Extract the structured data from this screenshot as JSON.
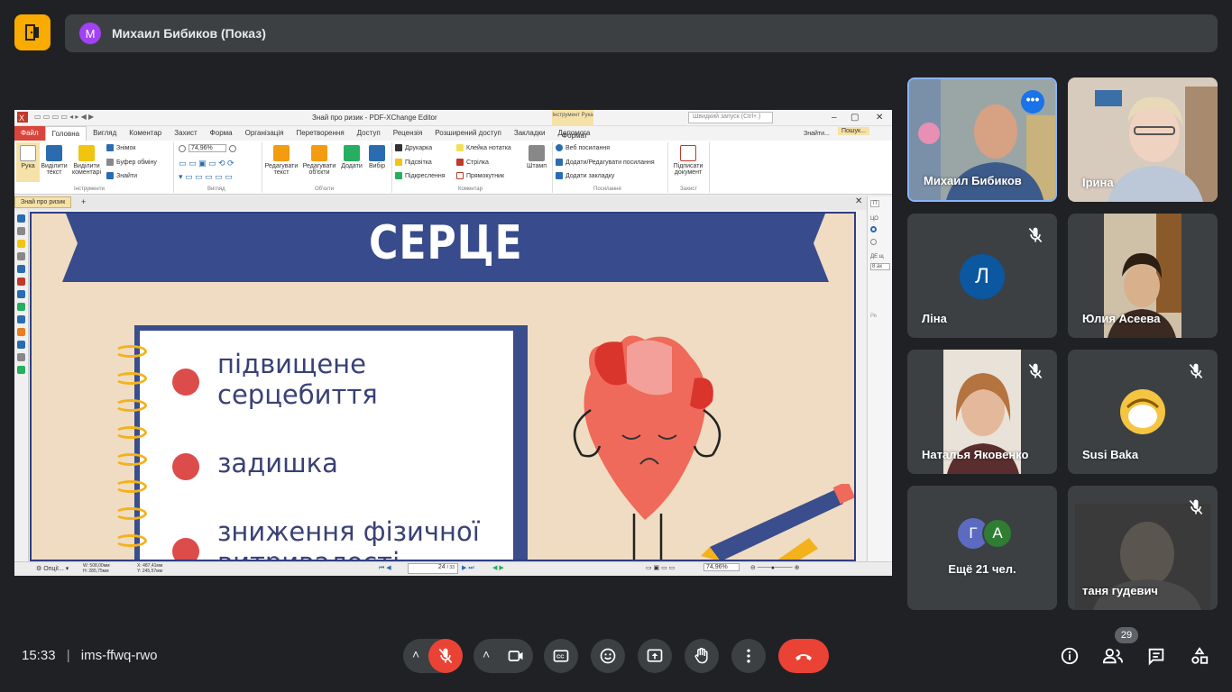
{
  "topbar": {
    "presenter_initial": "М",
    "presenter_label": "Михаил Бибиков (Показ)"
  },
  "pdf_editor": {
    "window_title": "Знай про ризик - PDF-XChange Editor",
    "quick_launch_placeholder": "Швидкий запуск (Ctrl+.)",
    "tool_context": "Інструмент Рука",
    "menu": [
      "Файл",
      "Головна",
      "Вигляд",
      "Коментар",
      "Захист",
      "Форма",
      "Організація",
      "Перетворення",
      "Доступ",
      "Рецензія",
      "Розширений доступ",
      "Закладки",
      "Допомога"
    ],
    "menu_format": "Формат",
    "menu_right": [
      "Знайти...",
      "Пошук..."
    ],
    "ribbon": {
      "hand": "Рука",
      "select_text": "Виділити текст",
      "select_comments": "Виділити коментарі",
      "snapshot": "Знімок",
      "clipboard": "Буфер обміну",
      "find": "Знайти",
      "zoom": "74,96%",
      "edit_text": "Редагувати текст",
      "edit_objects": "Редагувати об'єкти",
      "add": "Додати",
      "select": "Вибір",
      "typewriter": "Друкарка",
      "highlight": "Підсвітка",
      "underline": "Підкреслення",
      "sticky_note": "Клейка нотатка",
      "arrow": "Стрілка",
      "rectangle": "Прямокутник",
      "stamp": "Штамп",
      "web_links": "Веб посилання",
      "add_edit_links": "Додати/Редагувати посилання",
      "add_bookmark": "Додати закладку",
      "sign_document": "Підписати документ",
      "groups": [
        "Інструменти",
        "Вигляд",
        "Об'єкти",
        "Коментар",
        "Посилання",
        "Захист"
      ]
    },
    "doc_tab": "Знай про ризик",
    "status": {
      "options": "Опції...",
      "dims_w": "W: 508,00мм",
      "dims_h": "H: 285,75мм",
      "coord_x": "X: 487,41мм",
      "coord_y": "Y: 245,57мм",
      "page": "24",
      "page_total": "/ 33",
      "zoom": "74,96%"
    },
    "right_pane": [
      "П",
      "ЦО",
      "ДЕ щ",
      "8 ак",
      "Ре"
    ]
  },
  "slide": {
    "title": "СЕРЦЕ",
    "bullets": [
      "підвищене серцебиття",
      "задишка",
      "зниження фізичної витривалості"
    ],
    "colors": {
      "banner": "#384b8d",
      "background": "#efdcc2",
      "bullet": "#dc4c4a",
      "heart": "#ef6a5a"
    }
  },
  "participants": [
    {
      "name": "Михаил Бибиков",
      "type": "video",
      "active": true
    },
    {
      "name": "Ірина",
      "type": "video"
    },
    {
      "name": "Ліна",
      "type": "avatar",
      "initial": "Л",
      "color": "#1a5fb4",
      "muted": true
    },
    {
      "name": "Юлия Асеева",
      "type": "video"
    },
    {
      "name": "Наталья Яковенко",
      "type": "video",
      "muted": true
    },
    {
      "name": "Susi Baka",
      "type": "avatar-image",
      "muted": true
    },
    {
      "name": "Ещё 21 чел.",
      "type": "more",
      "initials": [
        "Г",
        "А"
      ],
      "colors": [
        "#5c6bc0",
        "#2e7d32"
      ]
    },
    {
      "name": "таня гудевич",
      "type": "video",
      "muted": true
    }
  ],
  "bottom": {
    "time": "15:33",
    "meeting_code": "ims-ffwq-rwo",
    "participant_count": "29"
  }
}
